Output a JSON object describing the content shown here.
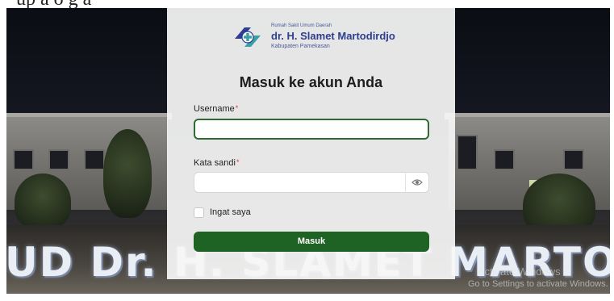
{
  "top_caption": "up   a   o   g     a",
  "brand": {
    "small_text": "Rumah Sakit Umum Daerah",
    "name": "dr. H. Slamet Martodirdjo",
    "sub_text": "Kabupaten Pamekasan",
    "logo_icon": "hospital-cross-logo-icon",
    "primary_color": "#2d3e8f",
    "accent_color": "#3aa0a8"
  },
  "login": {
    "heading": "Masuk ke akun Anda",
    "username_label": "Username",
    "username_value": "",
    "password_label": "Kata sandi",
    "password_value": "",
    "required_mark": "*",
    "toggle_icon": "eye-icon",
    "remember_label": "Ingat saya",
    "remember_checked": false,
    "submit_label": "Masuk",
    "submit_color": "#1e6324"
  },
  "background": {
    "sign_text": "UD Dr. H. SLAMET MARTODIR"
  },
  "watermark": {
    "title": "Activate Windows",
    "subtitle": "Go to Settings to activate Windows."
  }
}
